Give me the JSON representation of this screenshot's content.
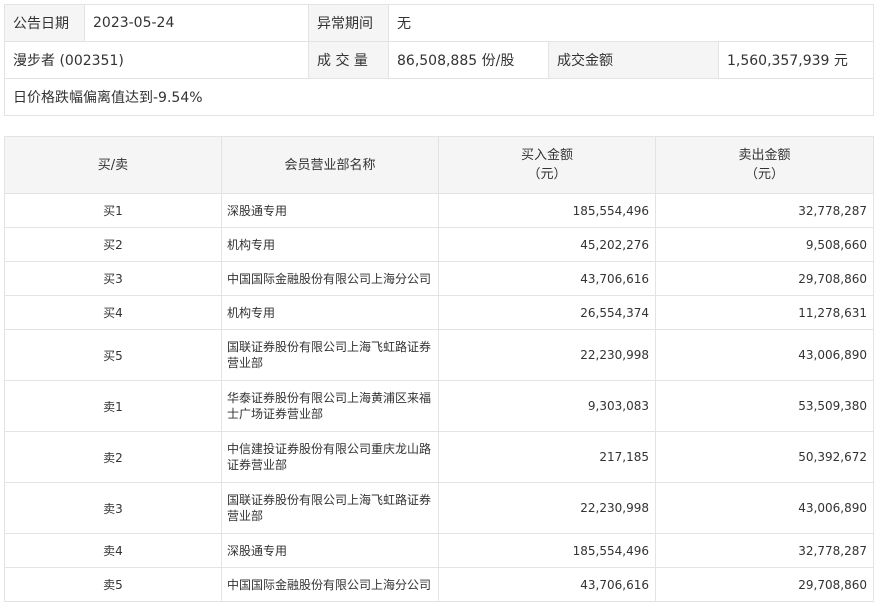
{
  "info": {
    "date_label": "公告日期",
    "date_value": "2023-05-24",
    "period_label": "异常期间",
    "period_value": "无",
    "stock_name": "漫步者 (002351)",
    "volume_label": "成 交 量",
    "volume_value": "86,508,885 份/股",
    "amount_label": "成交金额",
    "amount_value": "1,560,357,939 元",
    "note": "日价格跌幅偏离值达到-9.54%"
  },
  "table": {
    "headers": {
      "side": "买/卖",
      "broker": "会员营业部名称",
      "buy_line1": "买入金额",
      "buy_line2": "（元）",
      "sell_line1": "卖出金额",
      "sell_line2": "（元）"
    },
    "rows": [
      {
        "side": "买1",
        "broker": "深股通专用",
        "buy": "185,554,496",
        "sell": "32,778,287"
      },
      {
        "side": "买2",
        "broker": "机构专用",
        "buy": "45,202,276",
        "sell": "9,508,660"
      },
      {
        "side": "买3",
        "broker": "中国国际金融股份有限公司上海分公司",
        "buy": "43,706,616",
        "sell": "29,708,860"
      },
      {
        "side": "买4",
        "broker": "机构专用",
        "buy": "26,554,374",
        "sell": "11,278,631"
      },
      {
        "side": "买5",
        "broker": "国联证券股份有限公司上海飞虹路证券营业部",
        "buy": "22,230,998",
        "sell": "43,006,890"
      },
      {
        "side": "卖1",
        "broker": "华泰证券股份有限公司上海黄浦区来福士广场证券营业部",
        "buy": "9,303,083",
        "sell": "53,509,380"
      },
      {
        "side": "卖2",
        "broker": "中信建投证券股份有限公司重庆龙山路证券营业部",
        "buy": "217,185",
        "sell": "50,392,672"
      },
      {
        "side": "卖3",
        "broker": "国联证券股份有限公司上海飞虹路证券营业部",
        "buy": "22,230,998",
        "sell": "43,006,890"
      },
      {
        "side": "卖4",
        "broker": "深股通专用",
        "buy": "185,554,496",
        "sell": "32,778,287"
      },
      {
        "side": "卖5",
        "broker": "中国国际金融股份有限公司上海分公司",
        "buy": "43,706,616",
        "sell": "29,708,860"
      }
    ]
  }
}
